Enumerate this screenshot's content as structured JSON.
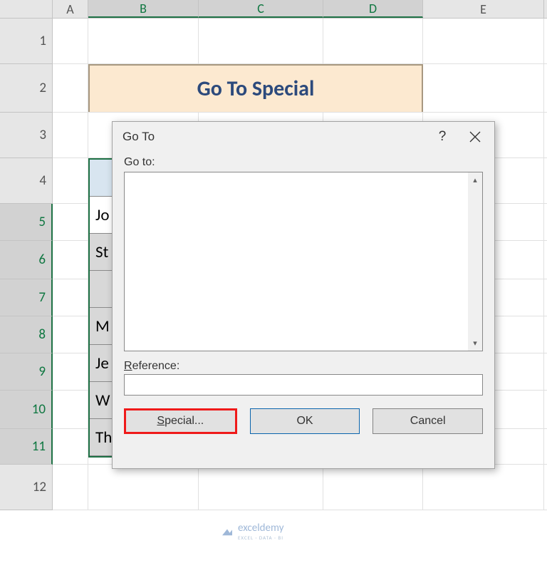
{
  "columns": {
    "A": "A",
    "B": "B",
    "C": "C",
    "D": "D",
    "E": "E"
  },
  "rows": {
    "r1": "1",
    "r2": "2",
    "r3": "3",
    "r4": "4",
    "r5": "5",
    "r6": "6",
    "r7": "7",
    "r8": "8",
    "r9": "9",
    "r10": "10",
    "r11": "11",
    "r12": "12"
  },
  "title_cell": "Go To Special",
  "data_cells": {
    "b5": "Jo",
    "b6": "St",
    "b7": "",
    "b8": "M",
    "b9": "Je",
    "b10": "W",
    "b11": "Thomas"
  },
  "dialog": {
    "title": "Go To",
    "help": "?",
    "goto_label": "Go to:",
    "ref_label_u": "R",
    "ref_label_rest": "eference:",
    "ref_value": "",
    "special_u": "S",
    "special_rest": "pecial...",
    "ok": "OK",
    "cancel": "Cancel"
  },
  "watermark": {
    "text": "exceldemy",
    "sub": "EXCEL · DATA · BI"
  }
}
